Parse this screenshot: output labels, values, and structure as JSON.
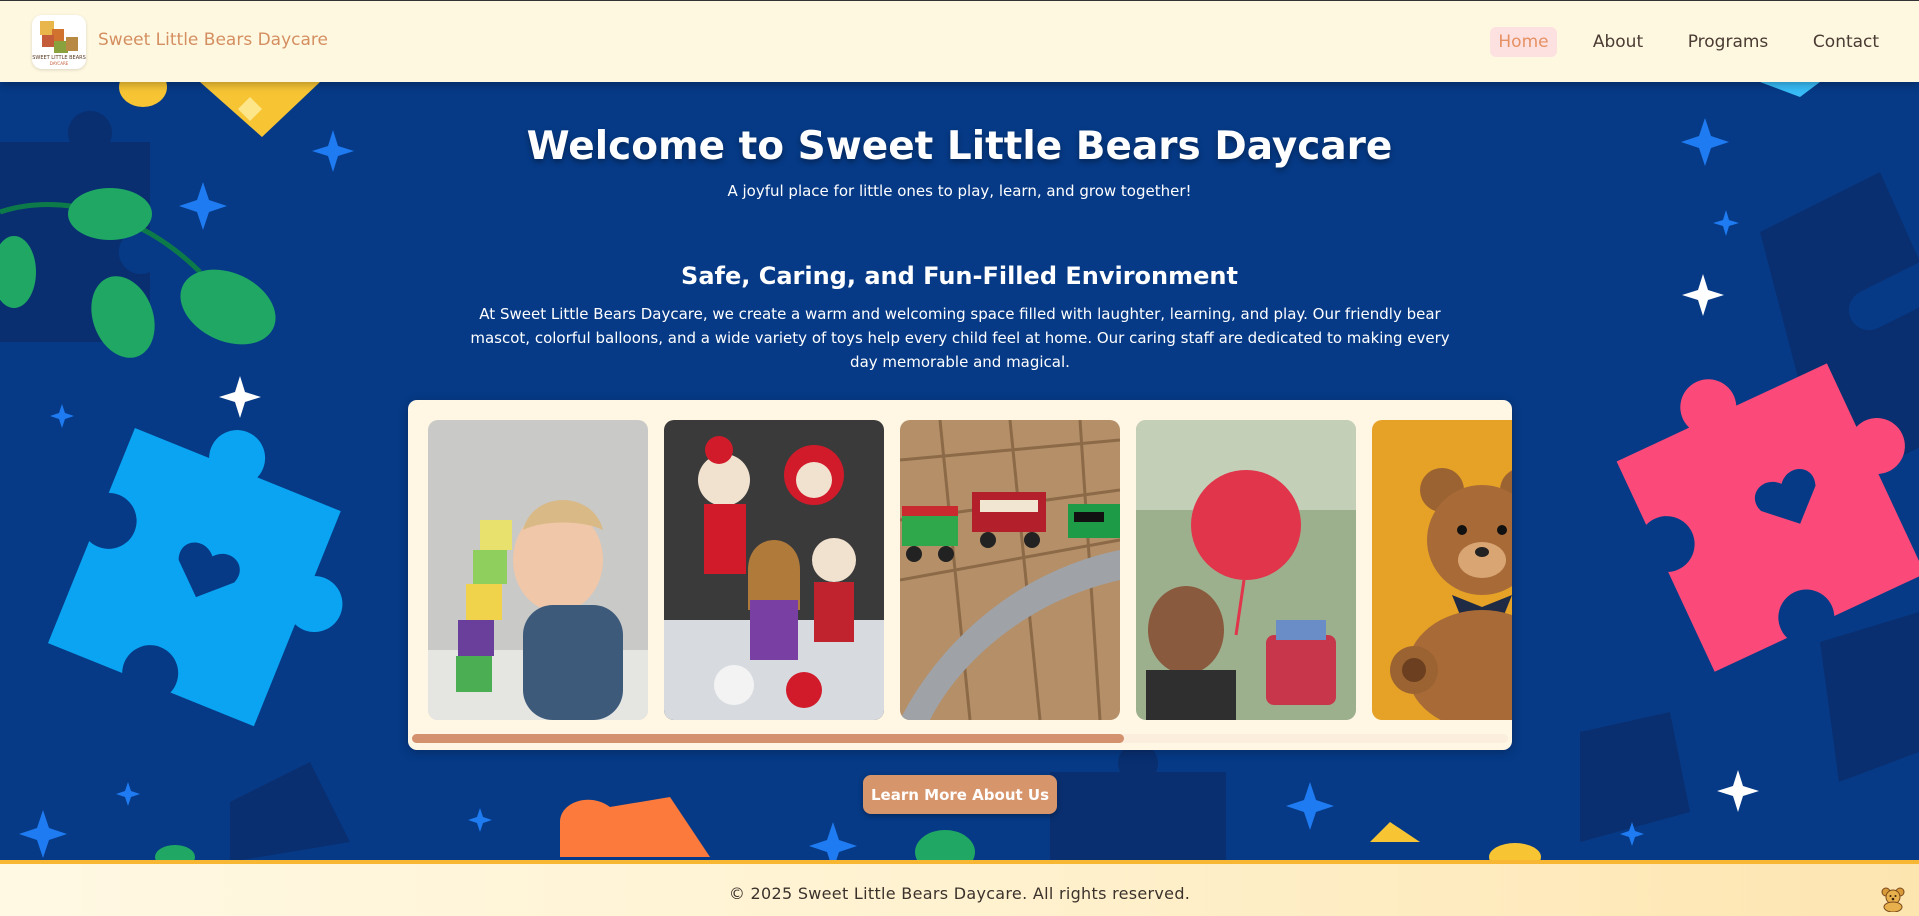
{
  "header": {
    "logo_icon": "daycare-blocks-logo",
    "brand": "Sweet Little Bears Daycare",
    "nav": [
      {
        "label": "Home",
        "active": true
      },
      {
        "label": "About",
        "active": false
      },
      {
        "label": "Programs",
        "active": false
      },
      {
        "label": "Contact",
        "active": false
      }
    ]
  },
  "hero": {
    "title": "Welcome to Sweet Little Bears Daycare",
    "subtitle": "A joyful place for little ones to play, learn, and grow together!"
  },
  "section": {
    "heading": "Safe, Caring, and Fun-Filled Environment",
    "body": "At Sweet Little Bears Daycare, we create a warm and welcoming space filled with laughter, learning, and play. Our friendly bear mascot, colorful balloons, and a wide variety of toys help every child feel at home. Our caring staff are dedicated to making every day memorable and magical."
  },
  "gallery": {
    "photos": [
      {
        "subject": "toddler-stacking-blocks"
      },
      {
        "subject": "crochet-dolls"
      },
      {
        "subject": "wooden-toy-train"
      },
      {
        "subject": "child-with-red-balloon"
      },
      {
        "subject": "teddy-bear"
      }
    ],
    "scroll_fraction": 0.65
  },
  "cta": {
    "label": "Learn More About Us"
  },
  "footer": {
    "text": "© 2025 Sweet Little Bears Daycare. All rights reserved.",
    "icon": "bear-icon"
  },
  "colors": {
    "header_bg": "#fff8e1",
    "brand": "#d48f61",
    "hero_bg": "#063a86",
    "accent": "#d7956b",
    "footer_border": "#f7b733"
  }
}
